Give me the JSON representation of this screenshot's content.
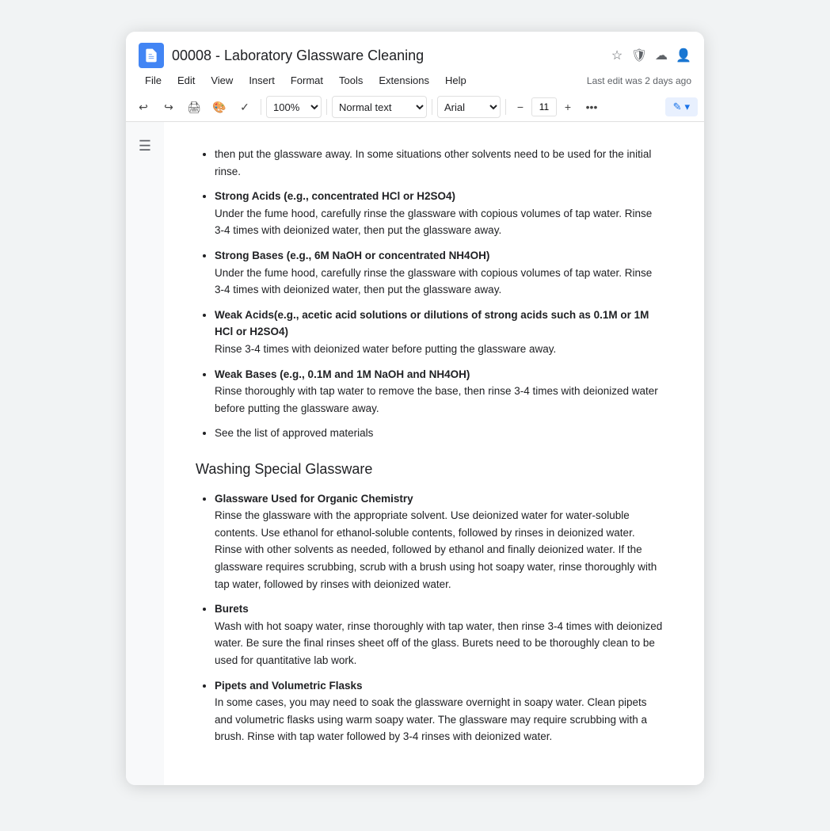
{
  "titleBar": {
    "docTitle": "00008 - Laboratory Glassware Cleaning",
    "icons": [
      "star",
      "shield",
      "cloud",
      "person"
    ]
  },
  "menuBar": {
    "items": [
      "File",
      "Edit",
      "View",
      "Insert",
      "Format",
      "Tools",
      "Extensions",
      "Help"
    ],
    "lastEdit": "Last edit was 2 days ago"
  },
  "toolbar": {
    "zoom": "100%",
    "style": "Normal text",
    "font": "Arial",
    "fontSize": "11",
    "editLabel": "✎"
  },
  "document": {
    "topBullets": [
      {
        "lead": "",
        "text": "then put the glassware away. In some situations other solvents need to be used for the initial rinse."
      },
      {
        "lead": "Strong Acids (e.g., concentrated HCl or H2SO4)",
        "text": "Under the fume hood, carefully rinse the glassware with copious volumes of tap water. Rinse 3-4 times with deionized water, then put the glassware away."
      },
      {
        "lead": "Strong Bases (e.g., 6M NaOH or concentrated NH4OH)",
        "text": "Under the fume hood, carefully rinse the glassware with copious volumes of tap water. Rinse 3-4 times with deionized water, then put the glassware away."
      },
      {
        "lead": "Weak Acids(e.g., acetic acid solutions or dilutions of strong acids such as 0.1M or 1M HCl or H2SO4)",
        "text": "Rinse 3-4 times with deionized water before putting the glassware away."
      },
      {
        "lead": "Weak Bases (e.g., 0.1M and 1M NaOH and NH4OH)",
        "text": "Rinse thoroughly with tap water to remove the base, then rinse 3-4 times with deionized water before putting the glassware away."
      },
      {
        "lead": "",
        "text": "See the list of approved materials"
      }
    ],
    "sectionHeading": "Washing Special Glassware",
    "specialBullets": [
      {
        "lead": "Glassware Used for Organic Chemistry",
        "text": "Rinse the glassware with the appropriate solvent. Use deionized water for water-soluble contents. Use ethanol for ethanol-soluble contents, followed by rinses in deionized water. Rinse with other solvents as needed, followed by ethanol and finally deionized water. If the glassware requires scrubbing, scrub with a brush using hot soapy water, rinse thoroughly with tap water, followed by rinses with deionized water."
      },
      {
        "lead": "Burets",
        "text": "Wash with hot soapy water, rinse thoroughly with tap water, then rinse 3-4 times with deionized water. Be sure the final rinses sheet off of the glass. Burets need to be thoroughly clean to be used for quantitative lab work."
      },
      {
        "lead": "Pipets and Volumetric Flasks",
        "text": "In some cases, you may need to soak the glassware overnight in soapy water. Clean pipets and volumetric flasks using warm soapy water. The glassware may require scrubbing with a brush. Rinse with tap water followed by 3-4 rinses with deionized water."
      }
    ]
  }
}
